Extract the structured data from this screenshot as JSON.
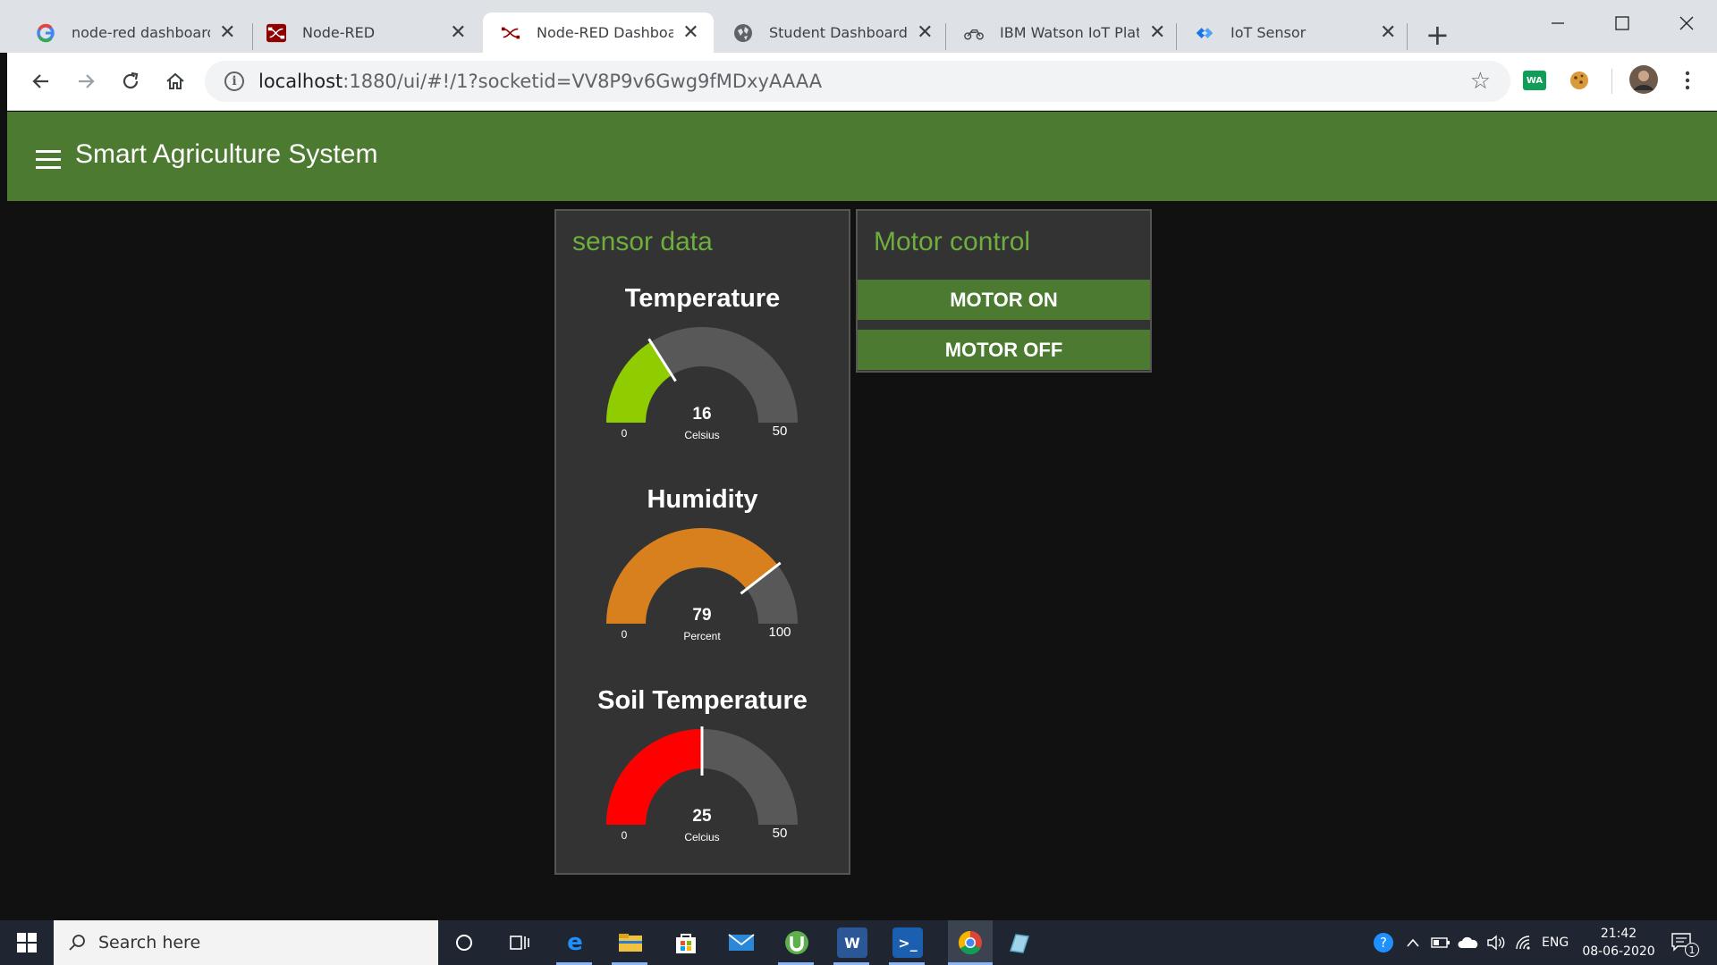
{
  "browser": {
    "tabs": [
      {
        "title": "node-red dashboard-h",
        "icon": "google-icon",
        "active": false
      },
      {
        "title": "Node-RED",
        "icon": "node-red-icon",
        "active": false
      },
      {
        "title": "Node-RED Dashboard",
        "icon": "node-red-flow-icon",
        "active": true
      },
      {
        "title": "Student Dashboard",
        "icon": "globe-icon",
        "active": false
      },
      {
        "title": "IBM Watson IoT Platfor",
        "icon": "iot-platform-icon",
        "active": false
      },
      {
        "title": "IoT Sensor",
        "icon": "node-red-blue-icon",
        "active": false
      }
    ],
    "url_host": "localhost",
    "url_rest": ":1880/ui/#!/1?socketid=VV8P9v6Gwg9fMDxyAAAA",
    "extension_badge": "WA"
  },
  "app": {
    "title": "Smart Agriculture System",
    "colors": {
      "appbar": "#4b7a30",
      "card_title": "#6dae3e",
      "button": "#4b7a30"
    }
  },
  "sensor_card": {
    "title": "sensor data",
    "gauges": [
      {
        "label": "Temperature",
        "value": 16,
        "unit": "Celsius",
        "min": 0,
        "max": 50,
        "color": "#8fcc00"
      },
      {
        "label": "Humidity",
        "value": 79,
        "unit": "Percent",
        "min": 0,
        "max": 100,
        "color": "#d87f1e"
      },
      {
        "label": "Soil Temperature",
        "value": 25,
        "unit": "Celcius",
        "min": 0,
        "max": 50,
        "color": "#ff0000"
      }
    ]
  },
  "motor_card": {
    "title": "Motor control",
    "on_label": "MOTOR ON",
    "off_label": "MOTOR OFF"
  },
  "taskbar": {
    "search_placeholder": "Search here",
    "language": "ENG",
    "time": "21:42",
    "date": "08-06-2020",
    "notification_count": "1"
  }
}
